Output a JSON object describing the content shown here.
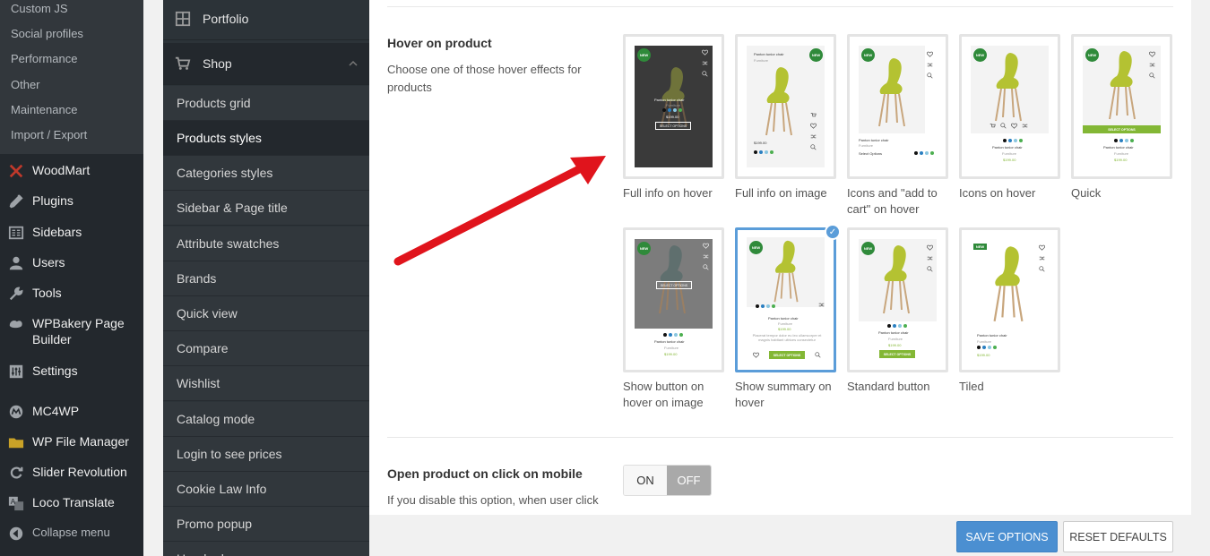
{
  "wp_menu": {
    "submenu": [
      "Custom JS",
      "Social profiles",
      "Performance",
      "Other",
      "Maintenance",
      "Import / Export"
    ],
    "items": [
      {
        "label": "WoodMart",
        "icon": "woodmart-icon"
      },
      {
        "label": "Plugins",
        "icon": "plugin-icon"
      },
      {
        "label": "Sidebars",
        "icon": "sidebars-icon"
      },
      {
        "label": "Users",
        "icon": "users-icon"
      },
      {
        "label": "Tools",
        "icon": "wrench-icon"
      },
      {
        "label": "WPBakery Page Builder",
        "icon": "wpbakery-icon"
      },
      {
        "label": "Settings",
        "icon": "settings-icon"
      },
      {
        "label": "MC4WP",
        "icon": "mc4wp-icon"
      },
      {
        "label": "WP File Manager",
        "icon": "folder-icon"
      },
      {
        "label": "Slider Revolution",
        "icon": "refresh-icon"
      },
      {
        "label": "Loco Translate",
        "icon": "translate-icon"
      },
      {
        "label": "Collapse menu",
        "icon": "collapse-icon"
      }
    ]
  },
  "options_nav": {
    "portfolio": "Portfolio",
    "shop": "Shop",
    "items": [
      "Products grid",
      "Products styles",
      "Categories styles",
      "Sidebar & Page title",
      "Attribute swatches",
      "Brands",
      "Quick view",
      "Compare",
      "Wishlist",
      "Catalog mode",
      "Login to see prices",
      "Cookie Law Info",
      "Promo popup",
      "Header banner"
    ],
    "active": "Products styles"
  },
  "hover_section": {
    "title": "Hover on product",
    "description": "Choose one of those hover effects for products",
    "options": [
      {
        "caption": "Full info on hover",
        "selected": false
      },
      {
        "caption": "Full info on image",
        "selected": false
      },
      {
        "caption": "Icons and \"add to cart\" on hover",
        "selected": false
      },
      {
        "caption": "Icons on hover",
        "selected": false
      },
      {
        "caption": "Quick",
        "selected": false
      },
      {
        "caption": "Show button on hover on image",
        "selected": false
      },
      {
        "caption": "Show summary on hover",
        "selected": true
      },
      {
        "caption": "Standard button",
        "selected": false
      },
      {
        "caption": "Tiled",
        "selected": false
      }
    ]
  },
  "preview_text": {
    "product": "Panton tunior chair",
    "category": "Furniture",
    "price": "$199.00",
    "badge": "NEW",
    "select_options": "SELECT OPTIONS",
    "select_options_short": "Select Options",
    "summary": "Placerat tempor dolor eu leo ullamcorper et magnis habitant ultrices consectetur"
  },
  "mobile_section": {
    "title": "Open product on click on mobile",
    "description": "If you disable this option, when user click",
    "toggle_on": "ON",
    "toggle_off": "OFF",
    "value": "OFF"
  },
  "footer": {
    "save": "SAVE OPTIONS",
    "reset": "RESET DEFAULTS"
  },
  "colors": {
    "accent_blue": "#5b9dd9",
    "brand_green": "#83b735",
    "badge_green": "#2f8a3a",
    "arrow_red": "#e0141c"
  }
}
